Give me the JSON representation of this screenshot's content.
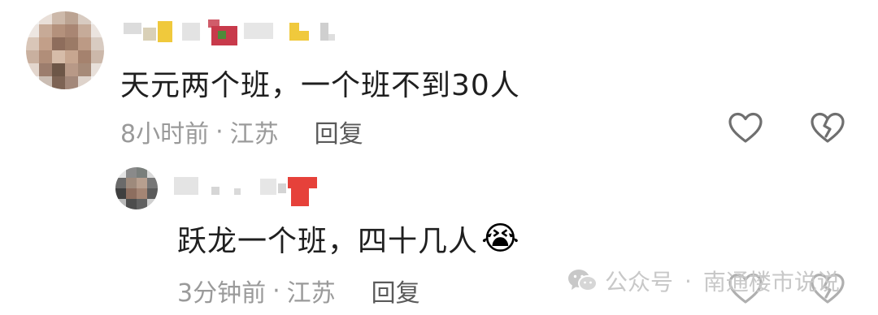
{
  "comments": [
    {
      "text": "天元两个班，一个班不到30人",
      "time": "8小时前",
      "location": "江苏",
      "separator": "·",
      "reply_label": "回复",
      "icons": [
        "like-heart-icon",
        "dislike-broken-heart-icon"
      ]
    },
    {
      "text": "跃龙一个班，四十几人",
      "emoji": "😭",
      "time": "3分钟前",
      "location": "江苏",
      "separator": "·",
      "reply_label": "回复"
    }
  ],
  "watermark": {
    "channel": "公众号",
    "separator": "·",
    "account": "南通楼市说说",
    "icon": "wechat-icon"
  },
  "colors": {
    "text": "#1f1f1f",
    "meta": "#9a9a9a",
    "reply": "#5a5a5a",
    "icon_stroke": "#6f6f6f"
  }
}
